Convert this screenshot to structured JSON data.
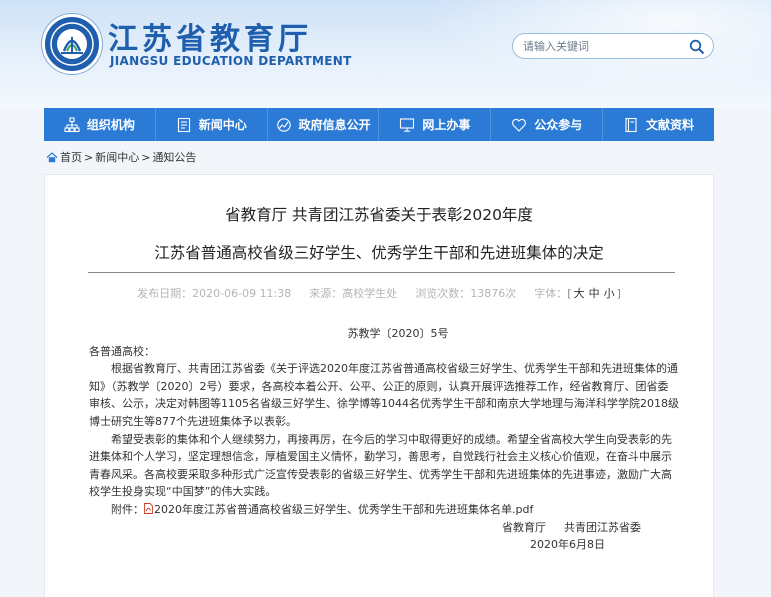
{
  "header": {
    "title": "江苏省教育厅",
    "subtitle": "JIANGSU EDUCATION DEPARTMENT",
    "search_placeholder": "请输入关键词"
  },
  "colors": {
    "brand_blue": "#1f5fae",
    "nav_blue": "#2b7bd6"
  },
  "nav": {
    "items": [
      {
        "label": "组织机构",
        "icon": "org-chart-icon"
      },
      {
        "label": "新闻中心",
        "icon": "document-icon"
      },
      {
        "label": "政府信息公开",
        "icon": "info-disclosure-icon"
      },
      {
        "label": "网上办事",
        "icon": "monitor-icon"
      },
      {
        "label": "公众参与",
        "icon": "heart-icon"
      },
      {
        "label": "文献资料",
        "icon": "book-icon"
      }
    ]
  },
  "breadcrumb": {
    "home": "首页",
    "items": [
      "新闻中心",
      "通知公告"
    ],
    "sep": ">"
  },
  "article": {
    "title_line1": "省教育厅 共青团江苏省委关于表彰2020年度",
    "title_line2": "江苏省普通高校省级三好学生、优秀学生干部和先进班集体的决定",
    "meta": {
      "date": "发布日期：2020-06-09 11:38",
      "source": "来源：高校学生处",
      "views": "浏览次数：13876次",
      "font_label": "字体：",
      "font_open": "[",
      "font_large": "大",
      "font_medium": "中",
      "font_small": "小",
      "font_close": "]"
    },
    "doc_number": "苏教学〔2020〕5号",
    "salutation": "各普通高校：",
    "paragraph1": "根据省教育厅、共青团江苏省委《关于评选2020年度江苏省普通高校省级三好学生、优秀学生干部和先进班集体的通知》（苏教学〔2020〕2号）要求，各高校本着公开、公平、公正的原则，认真开展评选推荐工作，经省教育厅、团省委审核、公示，决定对韩图等1105名省级三好学生、徐学博等1044名优秀学生干部和南京大学地理与海洋科学学院2018级博士研究生等877个先进班集体予以表彰。",
    "paragraph2": "希望受表彰的集体和个人继续努力，再接再厉，在今后的学习中取得更好的成绩。希望全省高校大学生向受表彰的先进集体和个人学习，坚定理想信念，厚植爱国主义情怀，勤学习，善思考，自觉践行社会主义核心价值观，在奋斗中展示青春风采。各高校要采取多种形式广泛宣传受表彰的省级三好学生、优秀学生干部和先进班集体的先进事迹，激励广大高校学生投身实现“中国梦”的伟大实践。",
    "attachment_label": "附件：",
    "attachment_name": "2020年度江苏省普通高校省级三好学生、优秀学生干部和先进班集体名单.pdf",
    "sign_org1": "省教育厅",
    "sign_org2": "共青团江苏省委",
    "sign_date": "2020年6月8日"
  }
}
